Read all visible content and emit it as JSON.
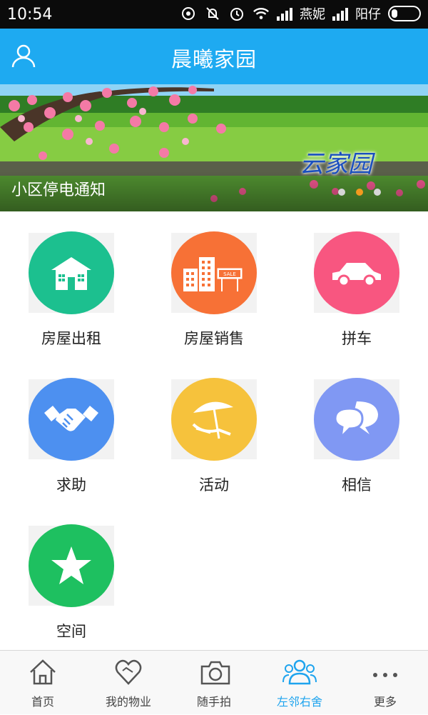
{
  "status_bar": {
    "time": "10:54",
    "carrier1": "燕妮",
    "carrier2": "阳仔"
  },
  "header": {
    "title": "晨曦家园",
    "user_icon": "user-icon"
  },
  "banner": {
    "caption": "小区停电通知",
    "brand_text": "云家园",
    "dots": 3,
    "active_dot": 2
  },
  "grid": {
    "items": [
      {
        "label": "房屋出租",
        "icon": "house-icon",
        "color": "#1cc08f"
      },
      {
        "label": "房屋销售",
        "icon": "buildings-sale-icon",
        "color": "#f77136"
      },
      {
        "label": "拼车",
        "icon": "car-icon",
        "color": "#f85680"
      },
      {
        "label": "求助",
        "icon": "handshake-icon",
        "color": "#4d90f0"
      },
      {
        "label": "活动",
        "icon": "beach-umbrella-icon",
        "color": "#f6c23c"
      },
      {
        "label": "相信",
        "icon": "chat-bubbles-icon",
        "color": "#8098f3"
      },
      {
        "label": "空间",
        "icon": "star-icon",
        "color": "#1ec060"
      }
    ]
  },
  "bottom_nav": {
    "items": [
      {
        "label": "首页",
        "icon": "home-icon"
      },
      {
        "label": "我的物业",
        "icon": "heart-icon"
      },
      {
        "label": "随手拍",
        "icon": "camera-icon"
      },
      {
        "label": "左邻右舍",
        "icon": "neighbors-icon",
        "active": true
      },
      {
        "label": "更多",
        "icon": "more-icon"
      }
    ],
    "active_color": "#1ea4ee"
  }
}
